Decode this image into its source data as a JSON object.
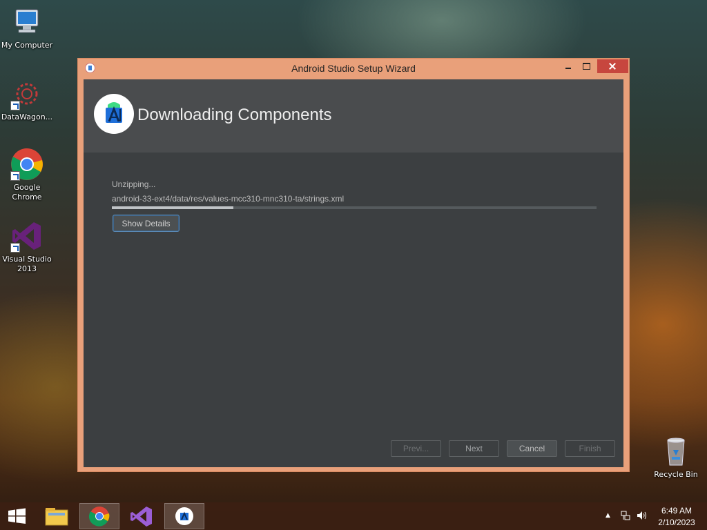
{
  "desktop": {
    "icons": [
      {
        "label": "My Computer"
      },
      {
        "label": "DataWagon..."
      },
      {
        "label": "Google Chrome"
      },
      {
        "label": "Visual Studio 2013"
      },
      {
        "label": "Recycle Bin"
      }
    ]
  },
  "window": {
    "title": "Android Studio Setup Wizard",
    "header_title": "Downloading Components",
    "status_text": "Unzipping...",
    "current_file": "android-33-ext4/data/res/values-mcc310-mnc310-ta/strings.xml",
    "progress_fraction": 0.25,
    "show_details_label": "Show Details",
    "buttons": {
      "previous": "Previ...",
      "next": "Next",
      "cancel": "Cancel",
      "finish": "Finish"
    }
  },
  "taskbar": {
    "time": "6:49 AM",
    "date": "2/10/2023",
    "pinned": [
      "start-icon",
      "file-explorer-icon",
      "chrome-icon",
      "visual-studio-icon",
      "android-studio-icon"
    ]
  },
  "colors": {
    "window_border": "#e9a07a",
    "close_button": "#c7463e",
    "dialog_bg": "#3c3f41",
    "header_bg": "#4a4c4e"
  }
}
